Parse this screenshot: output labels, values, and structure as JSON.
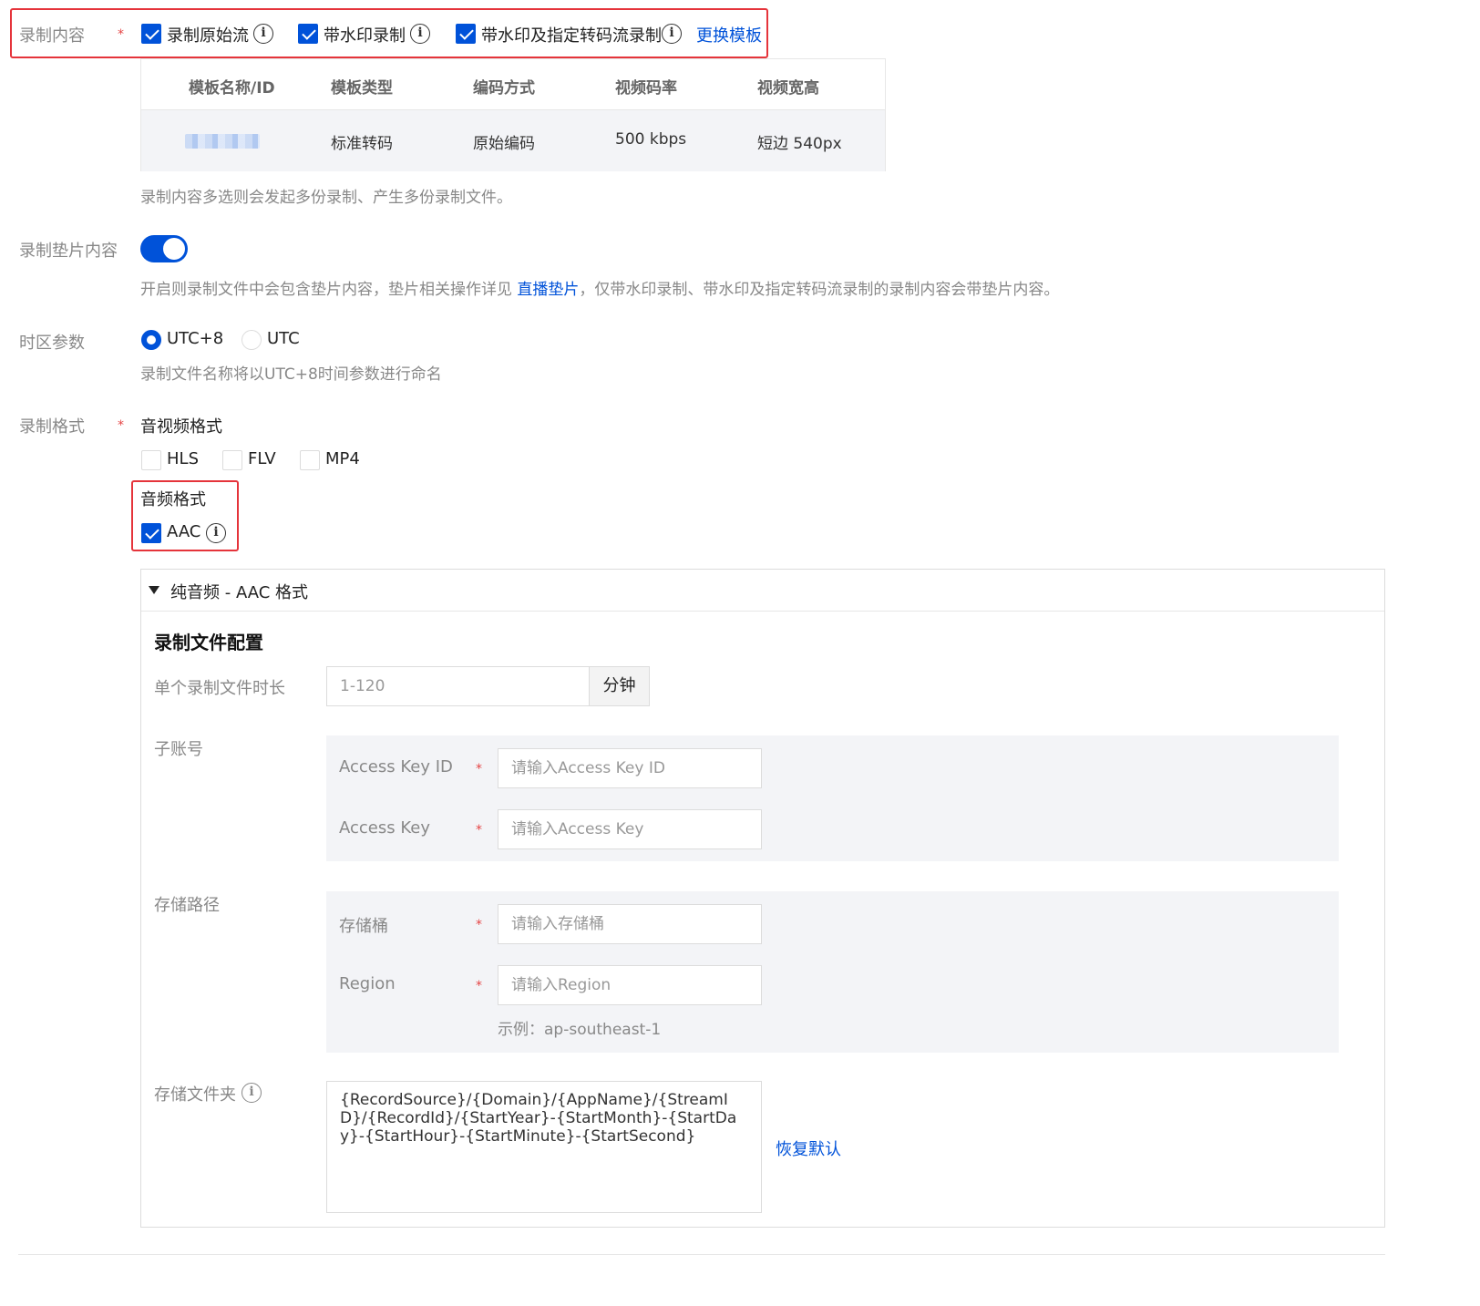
{
  "record_content": {
    "label": "录制内容",
    "required_mark": "*",
    "options": [
      {
        "label": "录制原始流",
        "checked": true,
        "info_icon": "info-icon"
      },
      {
        "label": "带水印录制",
        "checked": true,
        "info_icon": "info-icon"
      },
      {
        "label": "带水印及指定转码流录制",
        "checked": true,
        "info_icon": "info-icon"
      }
    ],
    "change_template_link": "更换模板",
    "table": {
      "headers": [
        "模板名称/ID",
        "模板类型",
        "编码方式",
        "视频码率",
        "视频宽高"
      ],
      "row": [
        "",
        "标准转码",
        "原始编码",
        "500 kbps",
        "短边 540px"
      ]
    },
    "help": "录制内容多选则会发起多份录制、产生多份录制文件。"
  },
  "slate": {
    "label": "录制垫片内容",
    "enabled": true,
    "help_before": "开启则录制文件中会包含垫片内容，垫片相关操作详见 ",
    "help_link": "直播垫片",
    "help_after": "，仅带水印录制、带水印及指定转码流录制的录制内容会带垫片内容。"
  },
  "timezone": {
    "label": "时区参数",
    "options": [
      {
        "label": "UTC+8",
        "selected": true
      },
      {
        "label": "UTC",
        "selected": false
      }
    ],
    "help": "录制文件名称将以UTC+8时间参数进行命名"
  },
  "record_format": {
    "label": "录制格式",
    "required_mark": "*",
    "av_title": "音视频格式",
    "av_options": [
      {
        "label": "HLS",
        "checked": false
      },
      {
        "label": "FLV",
        "checked": false
      },
      {
        "label": "MP4",
        "checked": false
      }
    ],
    "audio_title": "音频格式",
    "audio_options": [
      {
        "label": "AAC",
        "checked": true,
        "info_icon": "info-icon"
      }
    ]
  },
  "aac_panel": {
    "title": "纯音频 - AAC 格式",
    "expanded": true,
    "section_title": "录制文件配置",
    "duration": {
      "label": "单个录制文件时长",
      "placeholder": "1-120",
      "unit": "分钟"
    },
    "sub_account": {
      "label": "子账号",
      "fields": [
        {
          "label": "Access Key ID",
          "required_mark": "*",
          "placeholder": "请输入Access Key ID"
        },
        {
          "label": "Access Key",
          "required_mark": "*",
          "placeholder": "请输入Access Key"
        }
      ]
    },
    "storage_path": {
      "label": "存储路径",
      "fields": [
        {
          "label": "存储桶",
          "required_mark": "*",
          "placeholder": "请输入存储桶"
        },
        {
          "label": "Region",
          "required_mark": "*",
          "placeholder": "请输入Region"
        }
      ],
      "example": "示例：ap-southeast-1"
    },
    "storage_folder": {
      "label": "存储文件夹",
      "value": "{RecordSource}/{Domain}/{AppName}/{StreamID}/{RecordId}/{StartYear}-{StartMonth}-{StartDay}-{StartHour}-{StartMinute}-{StartSecond}",
      "restore_link": "恢复默认"
    }
  },
  "colors": {
    "primary": "#0052d9",
    "highlight_border": "#e5343b",
    "required": "#e54545",
    "panel_bg": "#f3f4f7"
  }
}
